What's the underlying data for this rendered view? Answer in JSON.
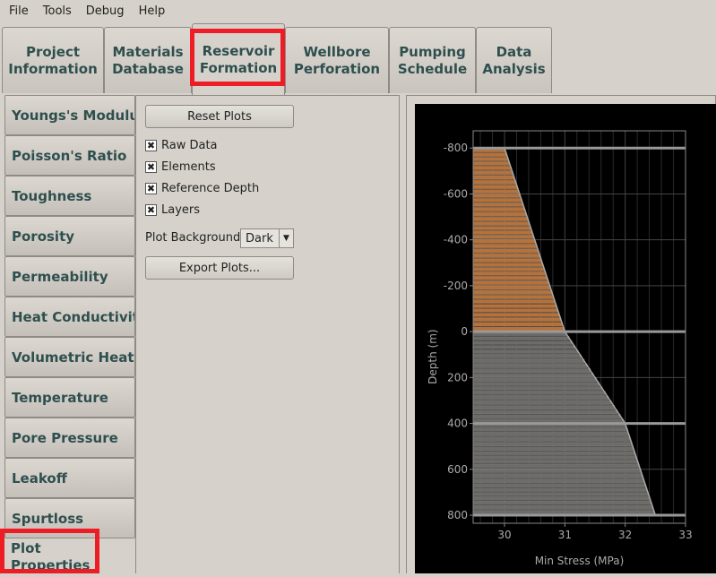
{
  "menu": [
    "File",
    "Tools",
    "Debug",
    "Help"
  ],
  "tabs": [
    {
      "label": "Project\nInformation"
    },
    {
      "label": "Materials\nDatabase"
    },
    {
      "label": "Reservoir\nFormation",
      "active": true
    },
    {
      "label": "Wellbore\nPerforation"
    },
    {
      "label": "Pumping\nSchedule"
    },
    {
      "label": "Data\nAnalysis"
    }
  ],
  "sidebar": [
    "Youngs's Modulus",
    "Poisson's Ratio",
    "Toughness",
    "Porosity",
    "Permeability",
    "Heat Conductivity",
    "Volumetric Heat Capacity",
    "Temperature",
    "Pore Pressure",
    "Leakoff",
    "Spurtloss"
  ],
  "sidebar_selected": "Plot\nProperties",
  "plot_properties": {
    "reset_label": "Reset Plots",
    "checkboxes": [
      {
        "label": "Raw Data",
        "checked": true
      },
      {
        "label": "Elements",
        "checked": true
      },
      {
        "label": "Reference Depth",
        "checked": true
      },
      {
        "label": "Layers",
        "checked": true
      }
    ],
    "background_label": "Plot Background",
    "background_value": "Dark",
    "export_label": "Export Plots..."
  },
  "highlight_color": "#ee1c25",
  "chart_data": {
    "type": "bar",
    "orientation": "horizontal",
    "xlabel": "Min Stress (MPa)",
    "ylabel": "Depth (m)",
    "xlim": [
      29.48,
      33
    ],
    "ylim": [
      -875,
      835
    ],
    "y_inverted": false,
    "xticks": [
      30,
      31,
      32,
      33
    ],
    "yticks": [
      -800,
      -600,
      -400,
      -200,
      0,
      200,
      400,
      600,
      800
    ],
    "grid": true,
    "background": "dark",
    "profile": {
      "depth": [
        -800,
        0,
        400,
        800
      ],
      "stress": [
        30,
        31,
        32,
        32.5
      ]
    },
    "element_size_m": 20,
    "layers": [
      {
        "top": -800,
        "bottom": 0,
        "color": "#b5723b"
      },
      {
        "top": 0,
        "bottom": 800,
        "color": "#6e6c68"
      }
    ],
    "layer_boundaries": [
      -800,
      0,
      400,
      800
    ]
  }
}
